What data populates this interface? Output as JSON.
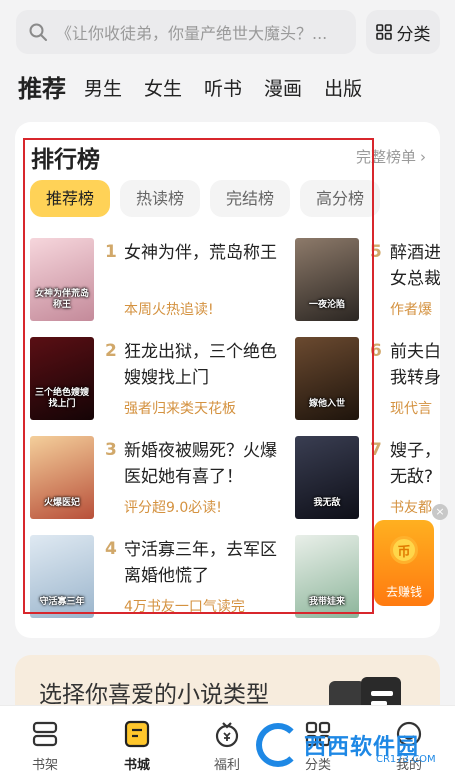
{
  "search": {
    "placeholder_text": "《让你收徒弟，你量产绝世大魔头？..."
  },
  "category_button": {
    "label": "分类"
  },
  "channels": [
    {
      "label": "推荐",
      "active": true
    },
    {
      "label": "男生",
      "active": false
    },
    {
      "label": "女生",
      "active": false
    },
    {
      "label": "听书",
      "active": false
    },
    {
      "label": "漫画",
      "active": false
    },
    {
      "label": "出版",
      "active": false
    }
  ],
  "ranking": {
    "title": "排行榜",
    "more_label": "完整榜单",
    "tabs": [
      {
        "label": "推荐榜",
        "active": true
      },
      {
        "label": "热读榜",
        "active": false
      },
      {
        "label": "完结榜",
        "active": false
      },
      {
        "label": "高分榜",
        "active": false
      }
    ],
    "left_books": [
      {
        "rank": "1",
        "title": "女神为伴，荒岛称王",
        "tag": "本周火热追读!",
        "cover_text": "女神为伴荒岛称王",
        "cover_colors": [
          "#f6d6dc",
          "#c48a9a"
        ]
      },
      {
        "rank": "2",
        "title": "狂龙出狱，三个绝色嫂嫂找上门",
        "tag": "强者归来类天花板",
        "cover_text": "三个绝色嫂嫂找上门",
        "cover_colors": [
          "#5a0f14",
          "#150406"
        ]
      },
      {
        "rank": "3",
        "title": "新婚夜被赐死？火爆医妃她有喜了！",
        "tag": "评分超9.0必读!",
        "cover_text": "火爆医妃",
        "cover_colors": [
          "#f4cf9b",
          "#b8503a"
        ]
      },
      {
        "rank": "4",
        "title": "守活寡三年，去军区离婚他慌了",
        "tag": "4万书友一口气读完",
        "cover_text": "守活寡三年",
        "cover_colors": [
          "#dfe9f2",
          "#9bb5cc"
        ]
      }
    ],
    "right_books": [
      {
        "rank": "5",
        "title": "醉酒进",
        "tag": "作者爆",
        "cover_text": "一夜沦陷",
        "cover_colors": [
          "#8d7a6a",
          "#2b2622"
        ]
      },
      {
        "rank": "6",
        "title": "前夫白",
        "tag": "现代言",
        "cover_text": "嫁他入世",
        "cover_colors": [
          "#6b4a30",
          "#1e140c"
        ]
      },
      {
        "rank": "7",
        "title": "嫂子，",
        "tag": "书友都",
        "cover_text": "我无敌",
        "cover_colors": [
          "#3a3e52",
          "#0e0f18"
        ]
      },
      {
        "rank": "8",
        "title": "",
        "tag": "",
        "cover_text": "我带娃来",
        "cover_colors": [
          "#e9efe9",
          "#8cb59a"
        ]
      }
    ],
    "right_title_line2": [
      "女总裁",
      "我转身",
      "无敌?",
      ""
    ]
  },
  "earn_badge": {
    "label": "去赚钱",
    "coin": "币"
  },
  "genre_prompt": {
    "text": "选择你喜爱的小说类型"
  },
  "bottom_nav": [
    {
      "label": "书架",
      "icon": "bookshelf-icon",
      "active": false
    },
    {
      "label": "书城",
      "icon": "bookstore-icon",
      "active": true
    },
    {
      "label": "福利",
      "icon": "welfare-icon",
      "active": false
    },
    {
      "label": "分类",
      "icon": "category-icon",
      "active": false
    },
    {
      "label": "我的",
      "icon": "profile-icon",
      "active": false
    }
  ],
  "watermark": {
    "text": "西西软件园",
    "sub": "CR173.COM"
  },
  "colors": {
    "accent": "#ffd257",
    "tag": "#d49240",
    "rank_number": "#d1a86a",
    "frame": "#d8262c"
  }
}
